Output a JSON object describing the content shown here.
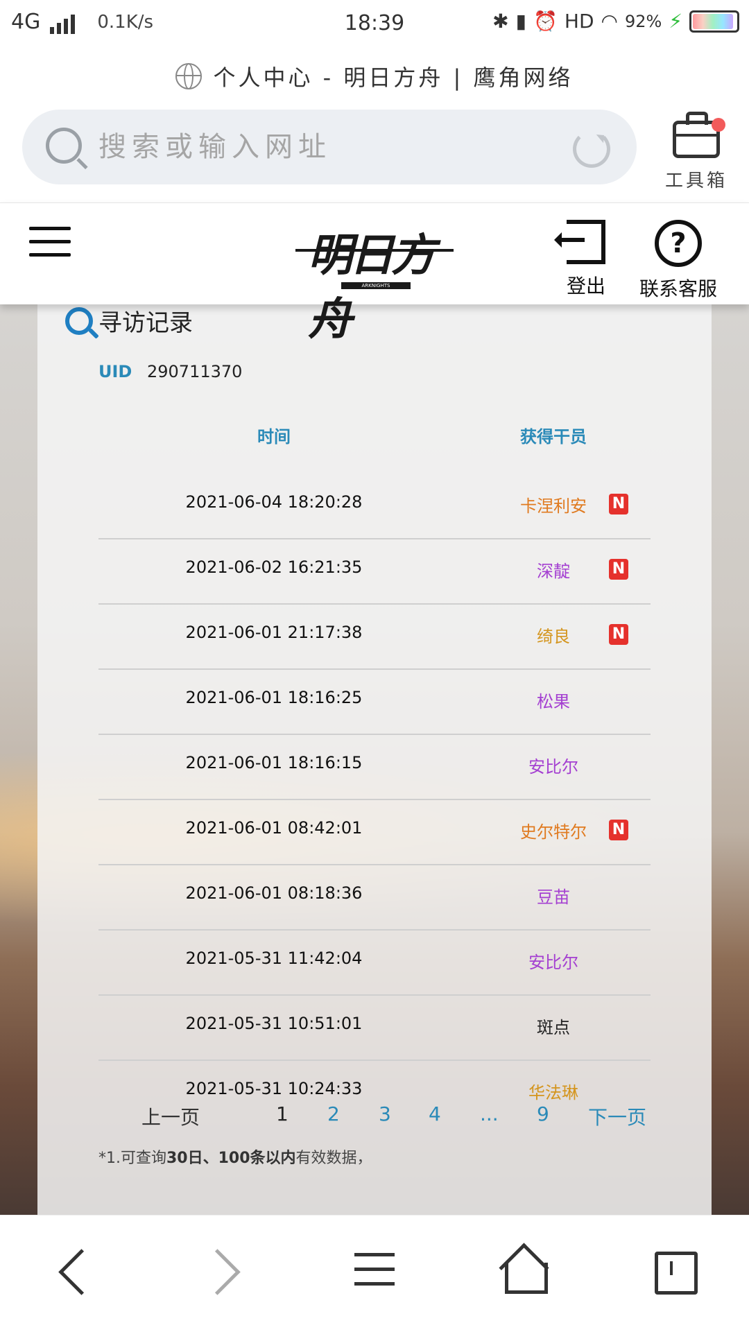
{
  "status_bar": {
    "network": "4G",
    "speed": "0.1K/s",
    "time": "18:39",
    "hd": "HD",
    "battery": "92%"
  },
  "browser": {
    "page_title": "个人中心 - 明日方舟 | 鹰角网络",
    "search_placeholder": "搜索或输入网址",
    "toolbox_label": "工具箱"
  },
  "site_header": {
    "logo_text": "明日方舟",
    "logo_sub": "ARKNIGHTS",
    "logout_label": "登出",
    "support_label": "联系客服"
  },
  "record": {
    "section_title": "寻访记录",
    "uid_label": "UID",
    "uid_value": "290711370",
    "columns": [
      "时间",
      "获得干员"
    ],
    "rows": [
      {
        "time": "2021-06-04 18:20:28",
        "operator": "卡涅利安",
        "color": "#e07a1f",
        "new": "N"
      },
      {
        "time": "2021-06-02 16:21:35",
        "operator": "深靛",
        "color": "#a43fd1",
        "new": "N"
      },
      {
        "time": "2021-06-01 21:17:38",
        "operator": "绮良",
        "color": "#d4951e",
        "new": "N"
      },
      {
        "time": "2021-06-01 18:16:25",
        "operator": "松果",
        "color": "#a43fd1",
        "new": ""
      },
      {
        "time": "2021-06-01 18:16:15",
        "operator": "安比尔",
        "color": "#a43fd1",
        "new": ""
      },
      {
        "time": "2021-06-01 08:42:01",
        "operator": "史尔特尔",
        "color": "#e07a1f",
        "new": "N"
      },
      {
        "time": "2021-06-01 08:18:36",
        "operator": "豆苗",
        "color": "#a43fd1",
        "new": ""
      },
      {
        "time": "2021-05-31 11:42:04",
        "operator": "安比尔",
        "color": "#a43fd1",
        "new": ""
      },
      {
        "time": "2021-05-31 10:51:01",
        "operator": "斑点",
        "color": "#222222",
        "new": ""
      },
      {
        "time": "2021-05-31 10:24:33",
        "operator": "华法琳",
        "color": "#d4951e",
        "new": ""
      }
    ]
  },
  "pager": {
    "prev": "上一页",
    "pages": [
      "1",
      "2",
      "3",
      "4",
      "...",
      "9"
    ],
    "next": "下一页",
    "current": "1"
  },
  "note": {
    "prefix": "*1.可查询",
    "bold": "30日、100条以内",
    "suffix": "有效数据，"
  }
}
